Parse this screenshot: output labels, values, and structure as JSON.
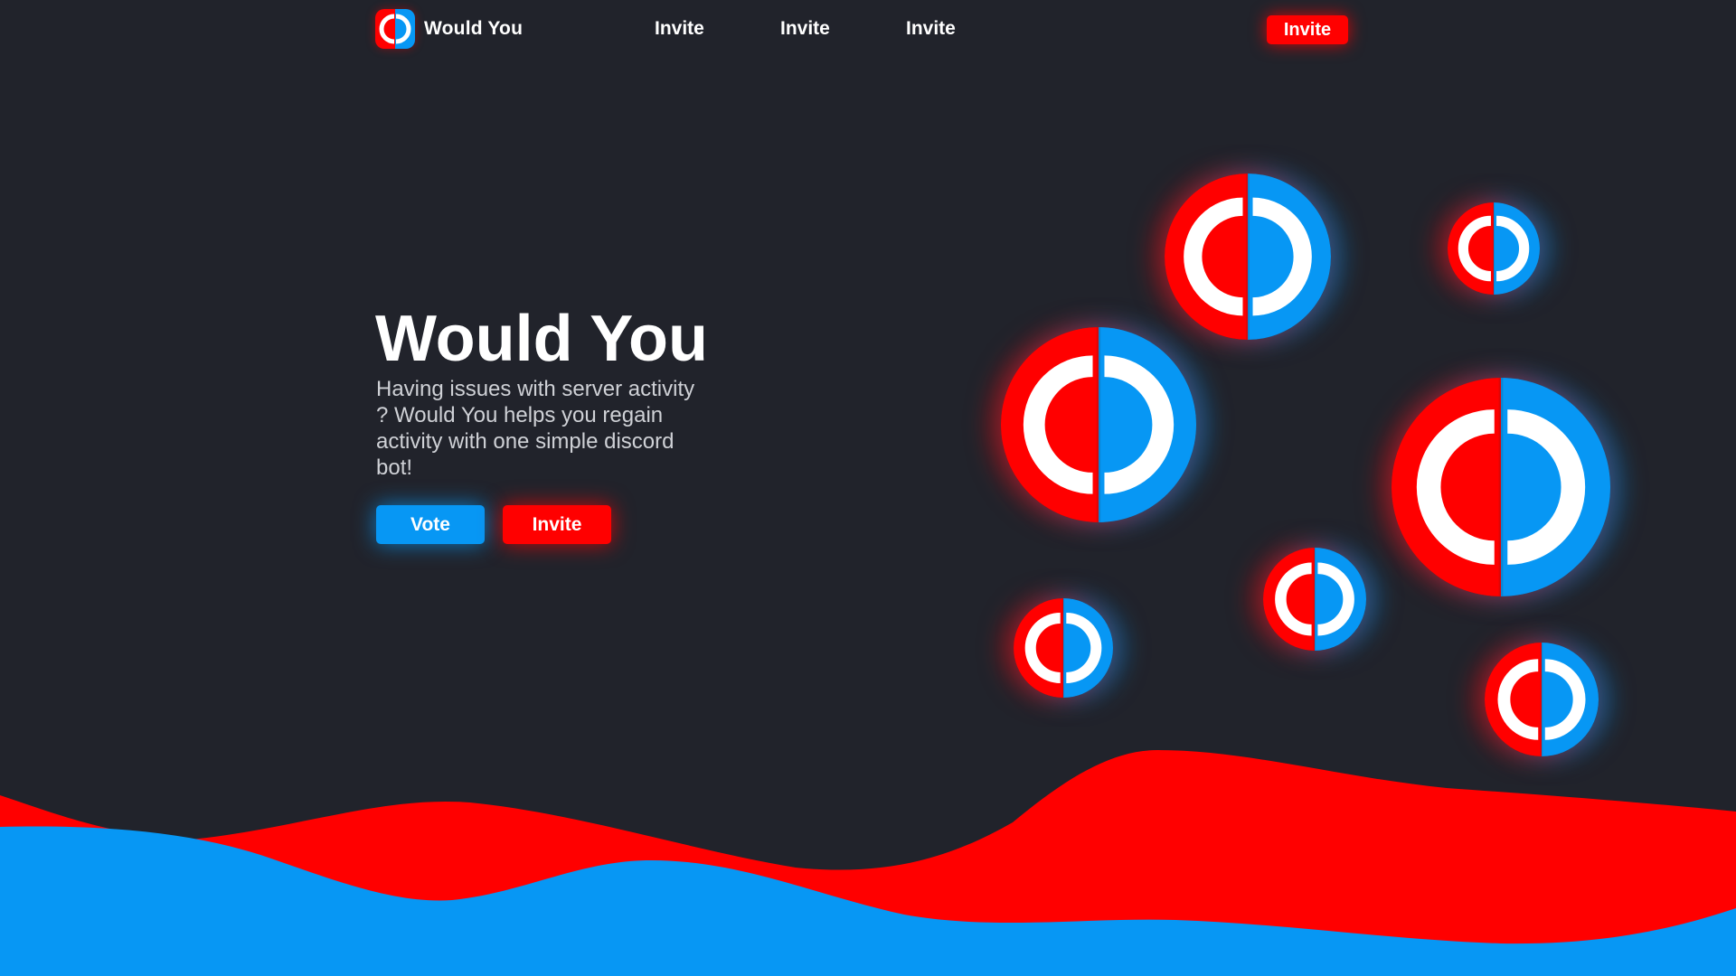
{
  "colors": {
    "background": "#21232b",
    "brand_red": "#ff0000",
    "brand_blue": "#0797f4",
    "text_primary": "#ffffff",
    "text_secondary": "#cfd1d6"
  },
  "nav": {
    "brand_name": "Would You",
    "brand_icon": "would-you-logo-icon",
    "links": [
      {
        "label": "Invite"
      },
      {
        "label": "Invite"
      },
      {
        "label": "Invite"
      }
    ],
    "cta_label": "Invite"
  },
  "hero": {
    "title": "Would You",
    "description": "Having issues with server activity ? Would You helps you regain activity with one simple discord bot!",
    "vote_label": "Vote",
    "invite_label": "Invite"
  },
  "decoration": {
    "orb_icon": "would-you-logo-icon",
    "orb_count": 8
  }
}
